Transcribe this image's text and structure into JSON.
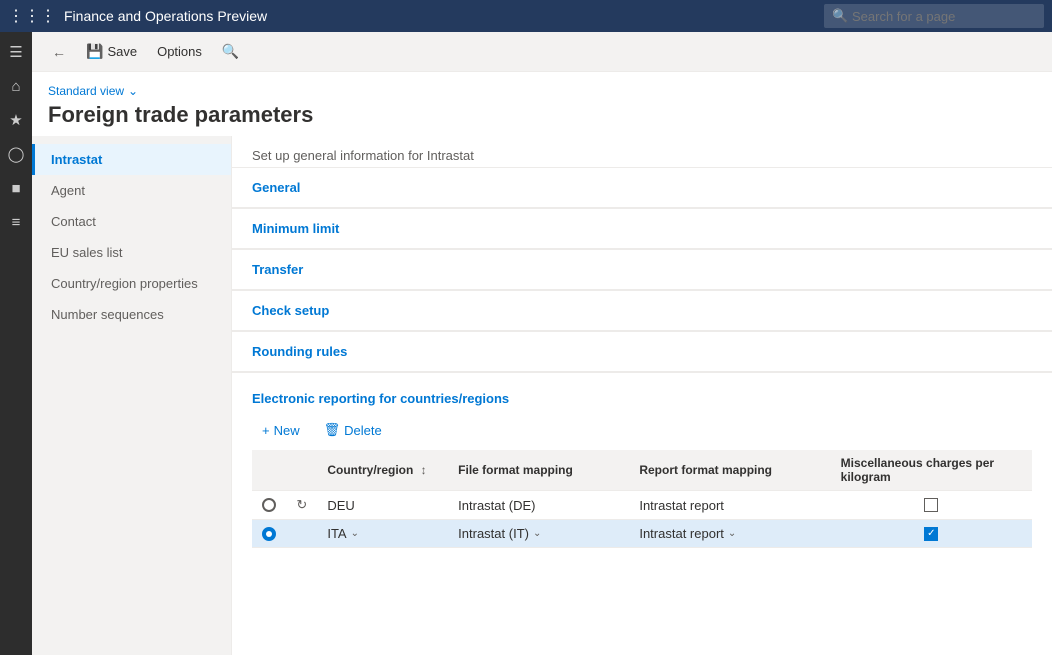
{
  "app": {
    "title": "Finance and Operations Preview",
    "search_placeholder": "Search for a page"
  },
  "toolbar": {
    "back_label": "",
    "save_label": "Save",
    "options_label": "Options",
    "search_icon": "🔍"
  },
  "page": {
    "view_label": "Standard view",
    "title": "Foreign trade parameters"
  },
  "nav": {
    "items": [
      {
        "id": "intrastat",
        "label": "Intrastat",
        "active": true
      },
      {
        "id": "agent",
        "label": "Agent",
        "active": false
      },
      {
        "id": "contact",
        "label": "Contact",
        "active": false
      },
      {
        "id": "eu-sales-list",
        "label": "EU sales list",
        "active": false
      },
      {
        "id": "country-region",
        "label": "Country/region properties",
        "active": false
      },
      {
        "id": "number-sequences",
        "label": "Number sequences",
        "active": false
      }
    ]
  },
  "form": {
    "subtitle": "Set up general information for Intrastat",
    "sections": [
      {
        "id": "general",
        "label": "General"
      },
      {
        "id": "minimum-limit",
        "label": "Minimum limit"
      },
      {
        "id": "transfer",
        "label": "Transfer"
      },
      {
        "id": "check-setup",
        "label": "Check setup"
      },
      {
        "id": "rounding-rules",
        "label": "Rounding rules"
      }
    ],
    "electronic_section": {
      "title": "Electronic reporting for countries/regions",
      "new_label": "New",
      "delete_label": "Delete",
      "columns": [
        {
          "id": "select",
          "label": ""
        },
        {
          "id": "refresh",
          "label": ""
        },
        {
          "id": "country",
          "label": "Country/region"
        },
        {
          "id": "file-format",
          "label": "File format mapping"
        },
        {
          "id": "report-format",
          "label": "Report format mapping"
        },
        {
          "id": "misc-charges",
          "label": "Miscellaneous charges per kilogram"
        }
      ],
      "rows": [
        {
          "id": 1,
          "selected": false,
          "country": "DEU",
          "file_format": "Intrastat (DE)",
          "report_format": "Intrastat report",
          "misc_checked": false
        },
        {
          "id": 2,
          "selected": true,
          "country": "ITA",
          "file_format": "Intrastat (IT)",
          "report_format": "Intrastat report",
          "misc_checked": true
        }
      ]
    }
  },
  "icon_sidebar": {
    "items": [
      {
        "id": "menu",
        "icon": "☰",
        "label": "menu-icon"
      },
      {
        "id": "home",
        "icon": "⌂",
        "label": "home-icon"
      },
      {
        "id": "favorites",
        "icon": "★",
        "label": "favorites-icon"
      },
      {
        "id": "recent",
        "icon": "⏱",
        "label": "recent-icon"
      },
      {
        "id": "workspaces",
        "icon": "▦",
        "label": "workspaces-icon"
      },
      {
        "id": "modules",
        "icon": "≡",
        "label": "modules-icon"
      }
    ]
  }
}
